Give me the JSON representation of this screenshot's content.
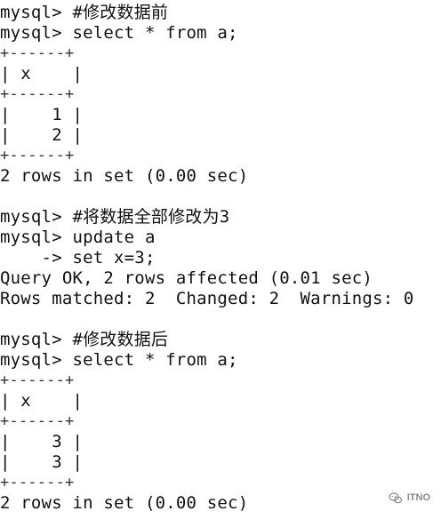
{
  "terminal": {
    "lines": [
      "mysql> #修改数据前",
      "mysql> select * from a;",
      "+------+",
      "| x    |",
      "+------+",
      "|    1 |",
      "|    2 |",
      "+------+",
      "2 rows in set (0.00 sec)",
      "",
      "mysql> #将数据全部修改为3",
      "mysql> update a",
      "    -> set x=3;",
      "Query OK, 2 rows affected (0.01 sec)",
      "Rows matched: 2  Changed: 2  Warnings: 0",
      "",
      "mysql> #修改数据后",
      "mysql> select * from a;",
      "+------+",
      "| x    |",
      "+------+",
      "|    3 |",
      "|    3 |",
      "+------+",
      "2 rows in set (0.00 sec)"
    ]
  },
  "watermark": {
    "icon": "wechat-icon",
    "text": "ITNO"
  }
}
